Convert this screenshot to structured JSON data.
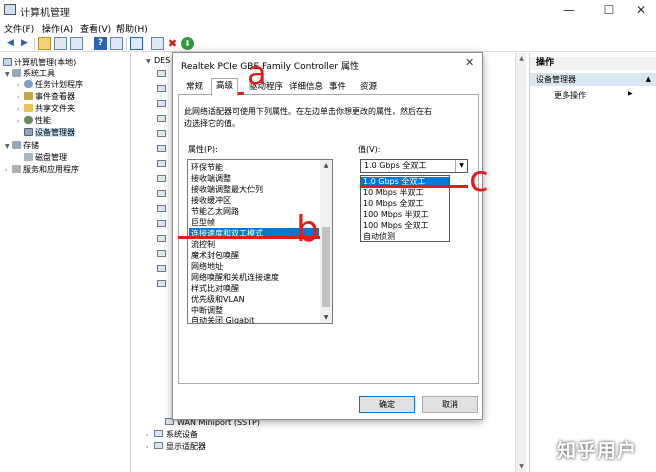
{
  "window": {
    "title": "计算机管理",
    "controls": [
      "—",
      "☐",
      "✕"
    ]
  },
  "menu": [
    "文件(F)",
    "操作(A)",
    "查看(V)",
    "帮助(H)"
  ],
  "tree": {
    "root": "计算机管理(本地)",
    "system_tools": "系统工具",
    "task_scheduler": "任务计划程序",
    "event_viewer": "事件查看器",
    "shared_folders": "共享文件夹",
    "performance": "性能",
    "device_manager": "设备管理器",
    "storage": "存储",
    "disk_management": "磁盘管理",
    "services_apps": "服务和应用程序"
  },
  "devices": {
    "root_prefix": "DES",
    "wan_miniport": "WAN Miniport (SSTP)",
    "system_devices": "系统设备",
    "display_adapters": "显示适配器"
  },
  "actions": {
    "header": "操作",
    "section": "设备管理器",
    "more": "更多操作"
  },
  "dialog": {
    "title": "Realtek PCIe GBE Family Controller 属性",
    "close": "✕",
    "tabs": [
      "常规",
      "高级",
      "驱动程序",
      "详细信息",
      "事件",
      "资源"
    ],
    "active_tab": "高级",
    "description_line1": "此网络适配器可使用下列属性。在左边单击你想更改的属性，然后在右",
    "description_line2": "边选择它的值。",
    "properties_label": "属性(P):",
    "value_label": "值(V):",
    "properties": [
      "环保节能",
      "接收端调整",
      "接收端调整最大伫列",
      "接收缓冲区",
      "节能乙太网路",
      "巨型帧",
      "连接速度和双工模式",
      "流控制",
      "魔术封包唤醒",
      "网络地址",
      "网络唤醒和关机连接速度",
      "样式比对唤醒",
      "优先级和VLAN",
      "中断调整",
      "自动关闭 Gigabit"
    ],
    "selected_property": "连接速度和双工模式",
    "value_current": "1.0 Gbps 全双工",
    "value_options": [
      "1.0 Gbps 全双工",
      "10 Mbps 半双工",
      "10 Mbps 全双工",
      "100 Mbps 半双工",
      "100 Mbps 全双工",
      "自动侦测"
    ],
    "ok": "确定",
    "cancel": "取消"
  },
  "annotations": {
    "a": "a",
    "b": "b",
    "c": "c",
    "color": "#e31b1b"
  },
  "watermark": "知乎用户"
}
